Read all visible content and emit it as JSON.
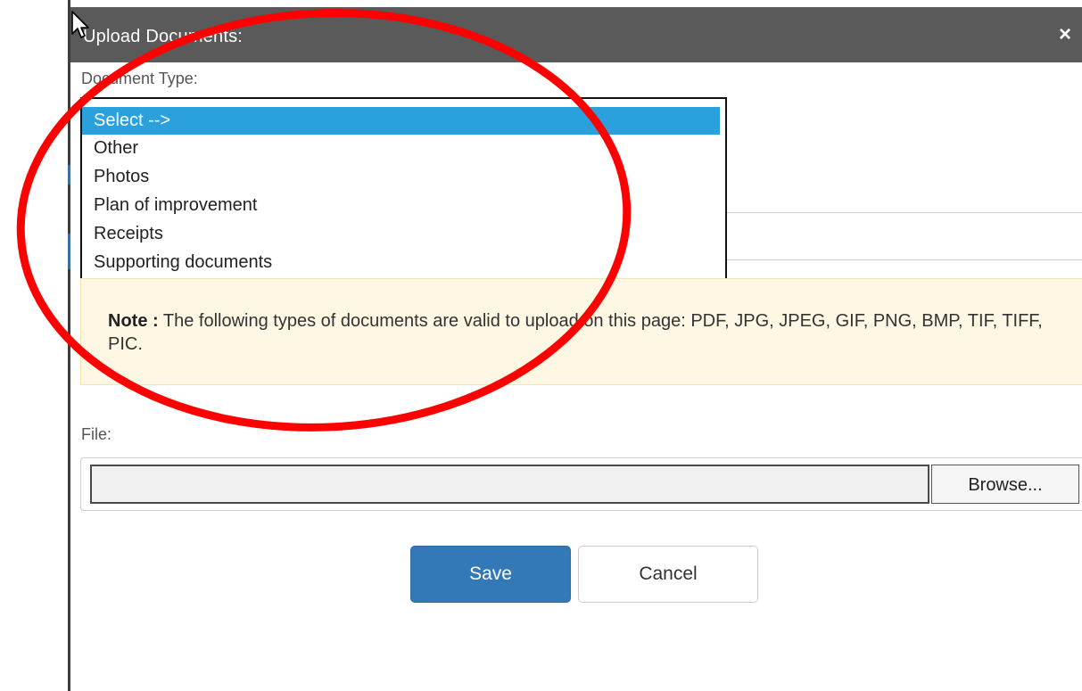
{
  "dialog": {
    "title": "Upload Documents:",
    "close_icon": "close-icon"
  },
  "document_type": {
    "label": "Document Type:",
    "options": [
      "Select -->",
      "Other",
      "Photos",
      "Plan of improvement",
      "Receipts",
      "Supporting documents"
    ],
    "selected": "Select -->"
  },
  "note": {
    "prefix": "Note :",
    "text": " The following types of documents are valid to upload on this page: PDF, JPG, JPEG, GIF, PNG, BMP, TIF, TIFF, PIC."
  },
  "file": {
    "label": "File:",
    "value": "",
    "browse_label": "Browse..."
  },
  "actions": {
    "save_label": "Save",
    "cancel_label": "Cancel"
  },
  "colors": {
    "titlebar": "#5a5a5a",
    "selected_option": "#2aa0dd",
    "save_button": "#3378b7",
    "note_background": "#fdf7e3",
    "annotation_circle": "#ff0000"
  },
  "icons": {
    "close": "close-icon",
    "cursor": "mouse-pointer-icon"
  }
}
